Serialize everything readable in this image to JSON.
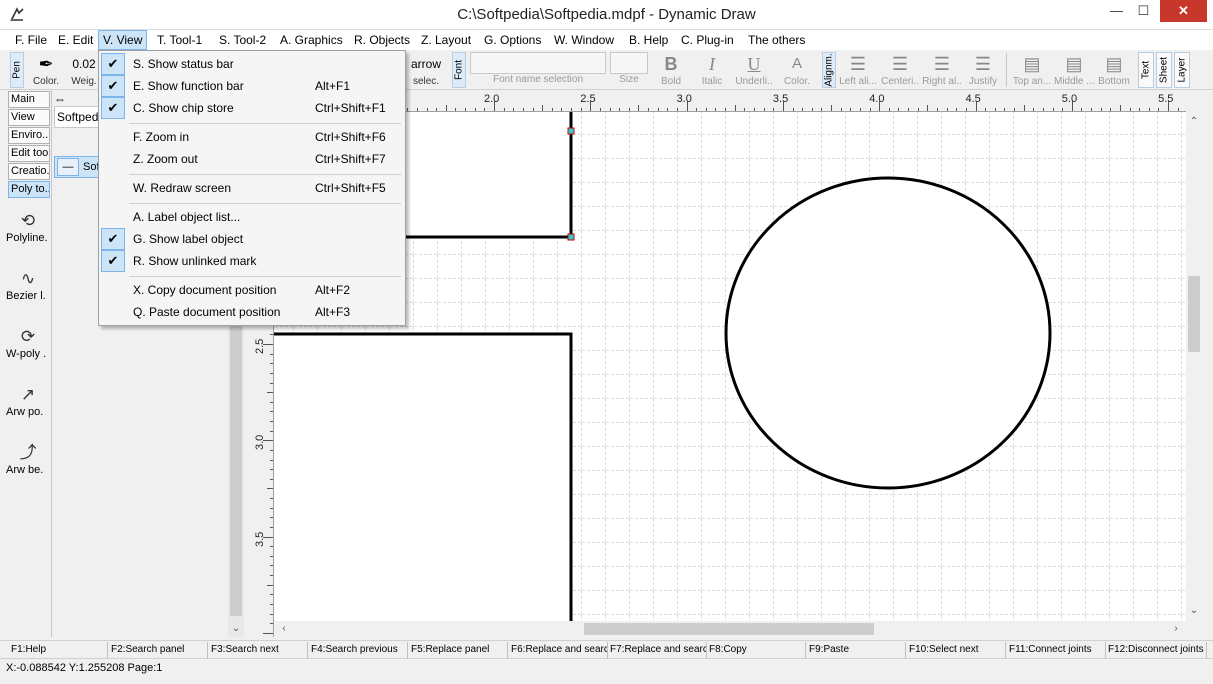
{
  "window": {
    "title": "C:\\Softpedia\\Softpedia.mdpf - Dynamic Draw",
    "minimize": "—",
    "maximize": "☐",
    "close": "✕"
  },
  "menu": [
    "F. File",
    "E. Edit",
    "V. View",
    "T. Tool-1",
    "S. Tool-2",
    "A. Graphics",
    "R. Objects",
    "Z. Layout",
    "G. Options",
    "W. Window",
    "B. Help",
    "C. Plug-in",
    "The others"
  ],
  "menu_active_index": 2,
  "toolbar": {
    "pen_label": "Pen",
    "color_label": "Color.",
    "weight_value": "0.02",
    "weight_label": "Weig.",
    "arrow_label": "arrow",
    "select_label": "selec.",
    "font_label": "Font",
    "font_name_label": "Font name selection",
    "size_label": "Size",
    "bold_glyph": "B",
    "bold_label": "Bold",
    "italic_glyph": "I",
    "italic_label": "Italic",
    "underline_glyph": "U",
    "underline_label": "Underli..",
    "fcolor_glyph": "A",
    "fcolor_label": "Color.",
    "align_label": "Alignm.",
    "left_align": "Left ali...",
    "center_align": "Centeri..",
    "right_align": "Right al..",
    "justify": "Justify",
    "top_align": "Top an...",
    "middle_align": "Middle ...",
    "bottom_align": "Bottom",
    "text_tab": "Text",
    "sheet_tab": "Sheet",
    "layer_tab": "Layer"
  },
  "sidebar": {
    "tabs": [
      "Main",
      "View",
      "Enviro...",
      "Edit too..",
      "Creatio..",
      "Poly to.."
    ],
    "selected_tab": 5,
    "tools": [
      {
        "label": "Polyline.",
        "icon": "polyline-icon"
      },
      {
        "label": "Bezier l.",
        "icon": "bezier-icon"
      },
      {
        "label": "W-poly .",
        "icon": "wpoly-icon"
      },
      {
        "label": "Arw po.",
        "icon": "arrow-polyline-icon"
      },
      {
        "label": "Arw be.",
        "icon": "arrow-bezier-icon"
      }
    ]
  },
  "panel": {
    "field_text": "Softped",
    "row_text": "Sof"
  },
  "ruler": {
    "top_labels": [
      "2.0",
      "2.5",
      "3.0",
      "3.5",
      "4.0",
      "4.5",
      "5.0",
      "5.5"
    ],
    "left_labels": [
      "2.5",
      "3.0",
      "3.5"
    ]
  },
  "view_menu": {
    "items": [
      {
        "label": "S. Show status bar",
        "shortcut": "",
        "checked": true
      },
      {
        "label": "E. Show function bar",
        "shortcut": "Alt+F1",
        "checked": true
      },
      {
        "label": "C. Show chip store",
        "shortcut": "Ctrl+Shift+F1",
        "checked": true
      },
      {
        "label": "F. Zoom in",
        "shortcut": "Ctrl+Shift+F6",
        "checked": false
      },
      {
        "label": "Z. Zoom out",
        "shortcut": "Ctrl+Shift+F7",
        "checked": false
      },
      {
        "label": "W. Redraw screen",
        "shortcut": "Ctrl+Shift+F5",
        "checked": false
      },
      {
        "label": "A. Label object list...",
        "shortcut": "",
        "checked": false
      },
      {
        "label": "G. Show label object",
        "shortcut": "",
        "checked": true
      },
      {
        "label": "R. Show unlinked mark",
        "shortcut": "",
        "checked": true
      },
      {
        "label": "X. Copy document position",
        "shortcut": "Alt+F2",
        "checked": false
      },
      {
        "label": "Q. Paste document position",
        "shortcut": "Alt+F3",
        "checked": false
      }
    ],
    "check_glyph": "✔"
  },
  "function_bar": [
    "F1:Help",
    "F2:Search panel",
    "F3:Search next",
    "F4:Search previous",
    "F5:Replace panel",
    "F6:Replace and searc",
    "F7:Replace and searc",
    "F8:Copy",
    "F9:Paste",
    "F10:Select next",
    "F11:Connect joints",
    "F12:Disconnect joints"
  ],
  "status": "X:-0.088542 Y:1.255208 Page:1"
}
